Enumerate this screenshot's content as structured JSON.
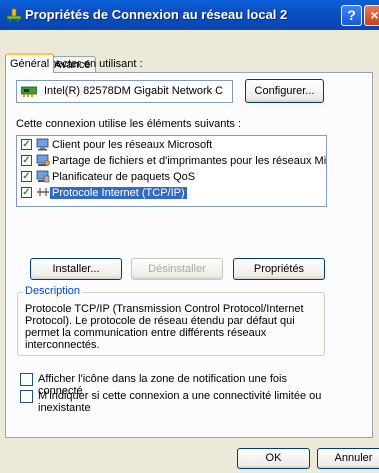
{
  "window": {
    "title": "Propriétés de Connexion au réseau local 2",
    "help_label": "?",
    "close_label": "×"
  },
  "tabs": [
    {
      "label": "Général",
      "active": true
    },
    {
      "label": "Avancé",
      "active": false
    }
  ],
  "connect": {
    "label": "Se connecter en utilisant :",
    "device": "Intel(R) 82578DM Gigabit Network C",
    "configure_button": "Configurer..."
  },
  "components": {
    "label": "Cette connexion utilise les éléments suivants :",
    "items": [
      {
        "label": "Client pour les réseaux Microsoft",
        "checked": true,
        "icon": "network-client-icon"
      },
      {
        "label": "Partage de fichiers et d'imprimantes pour les réseaux Mi...",
        "checked": true,
        "icon": "file-printer-share-icon"
      },
      {
        "label": "Planificateur de paquets QoS",
        "checked": true,
        "icon": "qos-scheduler-icon"
      },
      {
        "label": "Protocole Internet (TCP/IP)",
        "checked": true,
        "selected": true,
        "icon": "protocol-icon"
      }
    ]
  },
  "actions": {
    "install": "Installer...",
    "uninstall": "Désinstaller",
    "properties": "Propriétés"
  },
  "description": {
    "title": "Description",
    "text": "Protocole TCP/IP (Transmission Control Protocol/Internet Protocol). Le protocole de réseau étendu par défaut qui permet la communication entre différents réseaux interconnectés."
  },
  "options": {
    "show_icon": "Afficher l'icône dans la zone de notification une fois connecté",
    "notify_limited": "M'indiquer si cette connexion a une connectivité limitée ou inexistante"
  },
  "footer": {
    "ok": "OK",
    "cancel": "Annuler"
  },
  "colors": {
    "titlebar": "#0b4fc0",
    "selection": "#316ac5",
    "dialog_bg": "#ece9d8",
    "link_blue": "#0046d5"
  }
}
